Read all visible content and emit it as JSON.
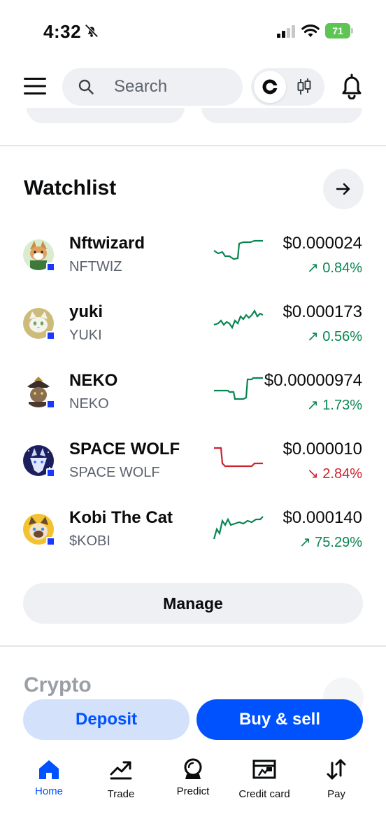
{
  "status_bar": {
    "time": "4:32",
    "battery": "71"
  },
  "search": {
    "placeholder": "Search"
  },
  "watchlist": {
    "title": "Watchlist",
    "items": [
      {
        "name": "Nftwizard",
        "ticker": "NFTWIZ",
        "price": "$0.000024",
        "change": "↗ 0.84%",
        "direction": "up"
      },
      {
        "name": "yuki",
        "ticker": "YUKI",
        "price": "$0.000173",
        "change": "↗ 0.56%",
        "direction": "up"
      },
      {
        "name": "NEKO",
        "ticker": "NEKO",
        "price": "$0.00000974",
        "change": "↗ 1.73%",
        "direction": "up"
      },
      {
        "name": "SPACE WOLF",
        "ticker": "SPACE WOLF",
        "price": "$0.000010",
        "change": "↘ 2.84%",
        "direction": "down"
      },
      {
        "name": "Kobi The Cat",
        "ticker": "$KOBI",
        "price": "$0.000140",
        "change": "↗ 75.29%",
        "direction": "up"
      }
    ],
    "manage_label": "Manage"
  },
  "crypto_section": {
    "title": "Crypto"
  },
  "actions": {
    "deposit_label": "Deposit",
    "buy_sell_label": "Buy & sell"
  },
  "nav": {
    "items": [
      {
        "label": "Home",
        "icon": "home-icon",
        "active": true
      },
      {
        "label": "Trade",
        "icon": "trade-chart-icon"
      },
      {
        "label": "Predict",
        "icon": "crystal-ball-icon"
      },
      {
        "label": "Credit card",
        "icon": "credit-card-icon"
      },
      {
        "label": "Pay",
        "icon": "transfer-arrows-icon"
      }
    ]
  },
  "colors": {
    "accent": "#0052ff",
    "positive": "#098551",
    "negative": "#cf202f",
    "surface": "#eef0f3"
  }
}
